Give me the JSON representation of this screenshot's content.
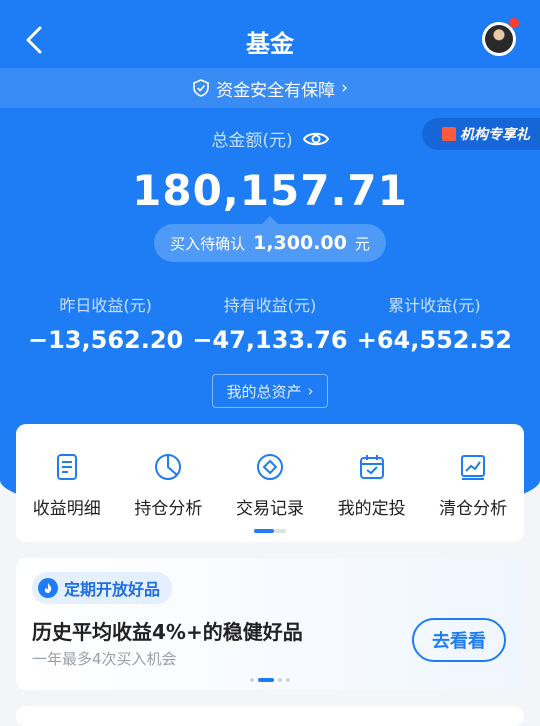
{
  "header": {
    "title": "基金"
  },
  "safety_banner": {
    "text": "资金安全有保障",
    "icon": "shield-check-icon",
    "arrow": "›"
  },
  "summary": {
    "total_label": "总金额(元)",
    "total_amount": "180,157.71",
    "pending_label": "买入待确认",
    "pending_amount": "1,300.00",
    "pending_unit": "元"
  },
  "promo_badge": {
    "text": "机构专享礼"
  },
  "stats": [
    {
      "label": "昨日收益(元)",
      "value": "−13,562.20"
    },
    {
      "label": "持有收益(元)",
      "value": "−47,133.76"
    },
    {
      "label": "累计收益(元)",
      "value": "+64,552.52"
    }
  ],
  "assets_button": {
    "label": "我的总资产",
    "arrow": "›"
  },
  "nav": [
    {
      "label": "收益明细",
      "icon": "document-icon"
    },
    {
      "label": "持仓分析",
      "icon": "pie-chart-icon"
    },
    {
      "label": "交易记录",
      "icon": "diamond-icon"
    },
    {
      "label": "我的定投",
      "icon": "calendar-check-icon"
    },
    {
      "label": "清仓分析",
      "icon": "trend-chart-icon"
    }
  ],
  "featured": {
    "tag": "定期开放好品",
    "headline": "历史平均收益4%+的稳健好品",
    "subtext": "一年最多4次买入机会",
    "button": "去看看"
  },
  "colors": {
    "primary": "#1e7df5",
    "background": "#f3f5f9",
    "alert_dot": "#ff3b30"
  }
}
